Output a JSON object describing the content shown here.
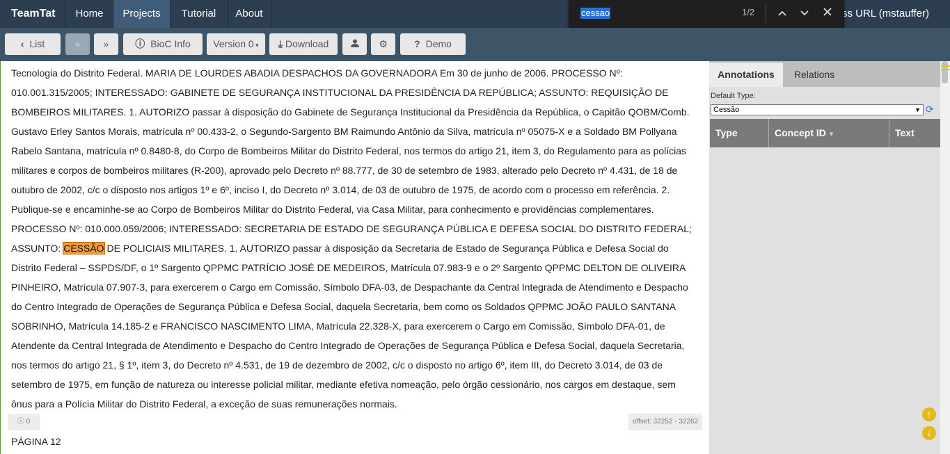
{
  "nav": {
    "brand": "TeamTat",
    "items": [
      "Home",
      "Projects",
      "Tutorial",
      "About"
    ],
    "right_text": "cess URL (mstauffer)"
  },
  "find": {
    "query": "cessao",
    "count": "1/2"
  },
  "toolbar": {
    "list": "List",
    "bioc": "BioC Info",
    "version": "Version 0",
    "download": "Download",
    "demo": "Demo"
  },
  "document": {
    "text_before": "Tecnologia do Distrito Federal. MARIA DE LOURDES ABADIA DESPACHOS DA GOVERNADORA Em 30 de junho de 2006. PROCESSO Nº: 010.001.315/2005; INTERESSADO: GABINETE DE SEGURANÇA INSTITUCIONAL DA PRESIDÊNCIA DA REPÚBLICA; ASSUNTO: REQUISIÇÃO DE BOMBEIROS MILITARES. 1. AUTORIZO passar à disposição do Gabinete de Segurança Institucional da Presidência da República, o Capitão QOBM/Comb. Gustavo Erley Santos Morais, matrícula nº 00.433-2, o Segundo-Sargento BM Raimundo Antônio da Silva, matrícula nº 05075-X e a Soldado BM Pollyana Rabelo Santana, matrícula nº 0.8480-8, do Corpo de Bombeiros Militar do Distrito Federal, nos termos do artigo 21, item 3, do Regulamento para as polícias militares e corpos de bombeiros militares (R-200), aprovado pelo Decreto nº 88.777, de 30 de setembro de 1983, alterado pelo Decreto nº 4.431, de 18 de outubro de 2002, c/c o disposto nos artigos 1º e 6º, inciso I, do Decreto nº 3.014, de 03 de outubro de 1975, de acordo com o processo em referência. 2. Publique-se e encaminhe-se ao Corpo de Bombeiros Militar do Distrito Federal, via Casa Militar, para conhecimento e providências complementares. PROCESSO Nº: 010.000.059/2006; INTERESSADO: SECRETARIA DE ESTADO DE SEGURANÇA PÚBLICA E DEFESA SOCIAL DO DISTRITO FEDERAL; ASSUNTO: ",
    "highlight": "CESSÃO",
    "text_after": " DE POLICIAIS MILITARES. 1. AUTORIZO passar à disposição da Secretaria de Estado de Segurança Pública e Defesa Social do Distrito Federal – SSPDS/DF, o 1º Sargento QPPMC PATRÍCIO JOSÉ DE MEDEIROS, Matrícula 07.983-9 e o 2º Sargento QPPMC DELTON DE OLIVEIRA PINHEIRO, Matrícula 07.907-3, para exercerem o Cargo em Comissão, Símbolo DFA-03, de Despachante da Central Integrada de Atendimento e Despacho do Centro Integrado de Operações de Segurança Pública e Defesa Social, daquela Secretaria, bem como os Soldados QPPMC JOÃO PAULO SANTANA SOBRINHO, Matrícula 14.185-2 e FRANCISCO NASCIMENTO LIMA, Matrícula 22.328-X, para exercerem o Cargo em Comissão, Símbolo DFA-01, de Atendente da Central Integrada de Atendimento e Despacho do Centro Integrado de Operações de Segurança Pública e Defesa Social, daquela Secretaria, nos termos do artigo 21, § 1º, item 3, do Decreto nº 4.531, de 19 de dezembro de 2002, c/c o disposto no artigo 6º, item III, do Decreto 3.014, de 03 de setembro de 1975, em função de natureza ou interesse policial militar, mediante efetiva nomeação, pelo órgão cessionário, nos cargos em destaque, sem ônus para a Polícia Militar do Distrito Federal, a exceção de suas remunerações normais.",
    "info_count": "0",
    "offset": "offset: 32252 - 32262",
    "page": "PÁGINA 12"
  },
  "panel": {
    "tabs": [
      "Annotations",
      "Relations"
    ],
    "default_type_label": "Default Type:",
    "default_type_value": "Cessão",
    "columns": [
      "Type",
      "Concept ID",
      "Text"
    ]
  }
}
